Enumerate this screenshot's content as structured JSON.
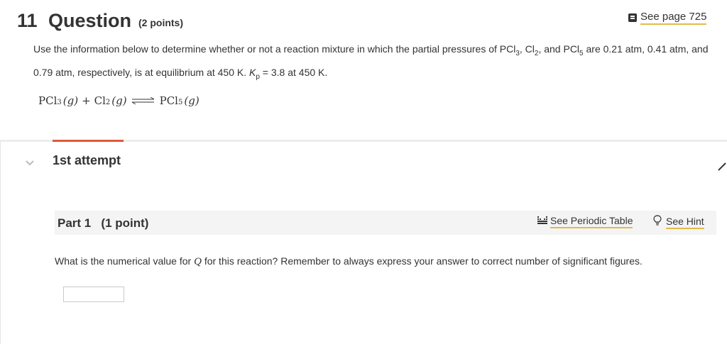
{
  "question": {
    "number": "11",
    "title": "Question",
    "points": "(2 points)",
    "see_page": "See page 725",
    "text": {
      "p1": "Use the information below to determine whether or not a reaction mixture in which the partial pressures of PCl",
      "s1": "3",
      "p2": ", Cl",
      "s2": "2",
      "p3": ", and PCl",
      "s3": "5",
      "p4": " are 0.21 atm, 0.41 atm, and 0.79 atm, respectively, is at equilibrium at 450 K.  ",
      "k": "K",
      "ksub": "p",
      "p5": " = 3.8 at 450 K."
    },
    "equation": {
      "r1": "PCl",
      "r1sub": "3",
      "r1state": "(g)",
      "plus": "+",
      "r2": "Cl",
      "r2sub": "2",
      "r2state": "(g)",
      "p1": "PCl",
      "p1sub": "5",
      "p1state": "(g)"
    }
  },
  "attempt": {
    "label": "1st attempt"
  },
  "part": {
    "title": "Part 1   (1 point)",
    "periodic_label": "See Periodic Table",
    "hint_label": "See Hint",
    "prompt_before": "What is the numerical value for ",
    "prompt_q": "Q",
    "prompt_after": " for this reaction? Remember to always express your answer to correct number of significant figures.",
    "answer_value": ""
  },
  "colors": {
    "accent": "#e05a3a",
    "link_underline": "#e6b94a"
  }
}
